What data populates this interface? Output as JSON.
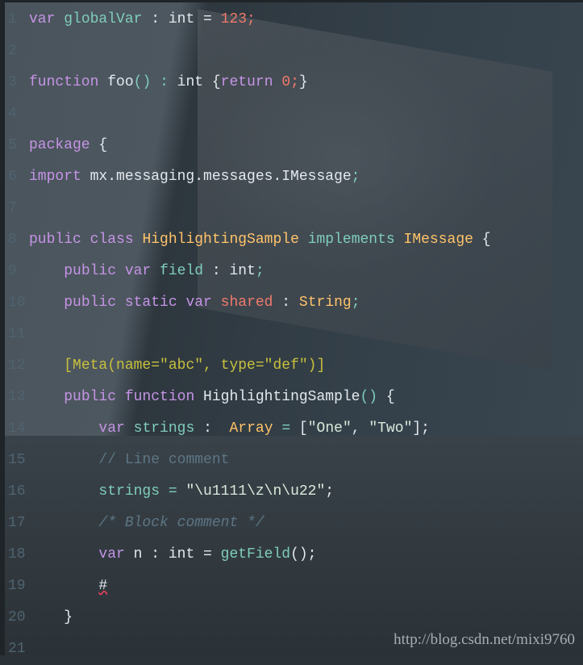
{
  "editor": {
    "lines": [
      [
        [
          "kw",
          "var"
        ],
        [
          "pl",
          " "
        ],
        [
          "id",
          "globalVar"
        ],
        [
          "pl",
          " : int = "
        ],
        [
          "num",
          "123;"
        ]
      ],
      [],
      [
        [
          "kw",
          "function"
        ],
        [
          "pl",
          " foo"
        ],
        [
          "id",
          "()"
        ],
        [
          "pl",
          " "
        ],
        [
          "id",
          ":"
        ],
        [
          "pl",
          " int {"
        ],
        [
          "kw",
          "return"
        ],
        [
          "pl",
          " "
        ],
        [
          "num",
          "0;"
        ],
        [
          "pl",
          "}"
        ]
      ],
      [],
      [
        [
          "kw",
          "package"
        ],
        [
          "pl",
          " {"
        ]
      ],
      [
        [
          "kw",
          "import"
        ],
        [
          "pl",
          " mx.messaging.messages.IMessage"
        ],
        [
          "id",
          ";"
        ]
      ],
      [],
      [
        [
          "kw",
          "public class"
        ],
        [
          "pl",
          " "
        ],
        [
          "type",
          "HighlightingSample"
        ],
        [
          "pl",
          " "
        ],
        [
          "id",
          "implements"
        ],
        [
          "pl",
          " "
        ],
        [
          "type",
          "IMessage"
        ],
        [
          "pl",
          " {"
        ]
      ],
      [
        [
          "pl",
          "    "
        ],
        [
          "kw",
          "public var"
        ],
        [
          "pl",
          " "
        ],
        [
          "id",
          "field"
        ],
        [
          "pl",
          " : int"
        ],
        [
          "id",
          ";"
        ]
      ],
      [
        [
          "pl",
          "    "
        ],
        [
          "kw",
          "public static var"
        ],
        [
          "pl",
          " "
        ],
        [
          "num",
          "shared"
        ],
        [
          "pl",
          " : "
        ],
        [
          "type",
          "String"
        ],
        [
          "id",
          ";"
        ]
      ],
      [],
      [
        [
          "pl",
          "    "
        ],
        [
          "meta",
          "[Meta(name=\"abc\", type=\"def\")]"
        ]
      ],
      [
        [
          "pl",
          "    "
        ],
        [
          "kw",
          "public function"
        ],
        [
          "pl",
          " HighlightingSample"
        ],
        [
          "id",
          "()"
        ],
        [
          "pl",
          " {"
        ]
      ],
      [
        [
          "pl",
          "        "
        ],
        [
          "kw",
          "var"
        ],
        [
          "pl",
          " "
        ],
        [
          "id",
          "strings"
        ],
        [
          "pl",
          " :  "
        ],
        [
          "type",
          "Array"
        ],
        [
          "pl",
          " "
        ],
        [
          "id",
          "="
        ],
        [
          "pl",
          " ["
        ],
        [
          "str",
          "\"One\""
        ],
        [
          "pl",
          ", "
        ],
        [
          "str",
          "\"Two\""
        ],
        [
          "pl",
          "];"
        ]
      ],
      [
        [
          "pl",
          "        "
        ],
        [
          "cm",
          "// Line comment"
        ]
      ],
      [
        [
          "pl",
          "        "
        ],
        [
          "id",
          "strings = "
        ],
        [
          "str",
          "\"\\u1111\\z\\n\\u22\""
        ],
        [
          "pl",
          ";"
        ]
      ],
      [
        [
          "pl",
          "        "
        ],
        [
          "cmi",
          "/* Block comment */"
        ]
      ],
      [
        [
          "pl",
          "        "
        ],
        [
          "kw",
          "var"
        ],
        [
          "pl",
          " n : int = "
        ],
        [
          "id",
          "getField"
        ],
        [
          "pl",
          "();"
        ]
      ],
      [
        [
          "pl",
          "        "
        ],
        [
          "err",
          "#"
        ]
      ],
      [
        [
          "pl",
          "    }"
        ]
      ],
      []
    ]
  },
  "watermark": "http://blog.csdn.net/mixi9760",
  "colors": {
    "keyword": "#c594e6",
    "identifier": "#7fcdbb",
    "number": "#f07a6c",
    "type": "#ffc46a",
    "metadata": "#c8c03e",
    "comment": "#5d7584",
    "error_underline": "#e0405a"
  }
}
